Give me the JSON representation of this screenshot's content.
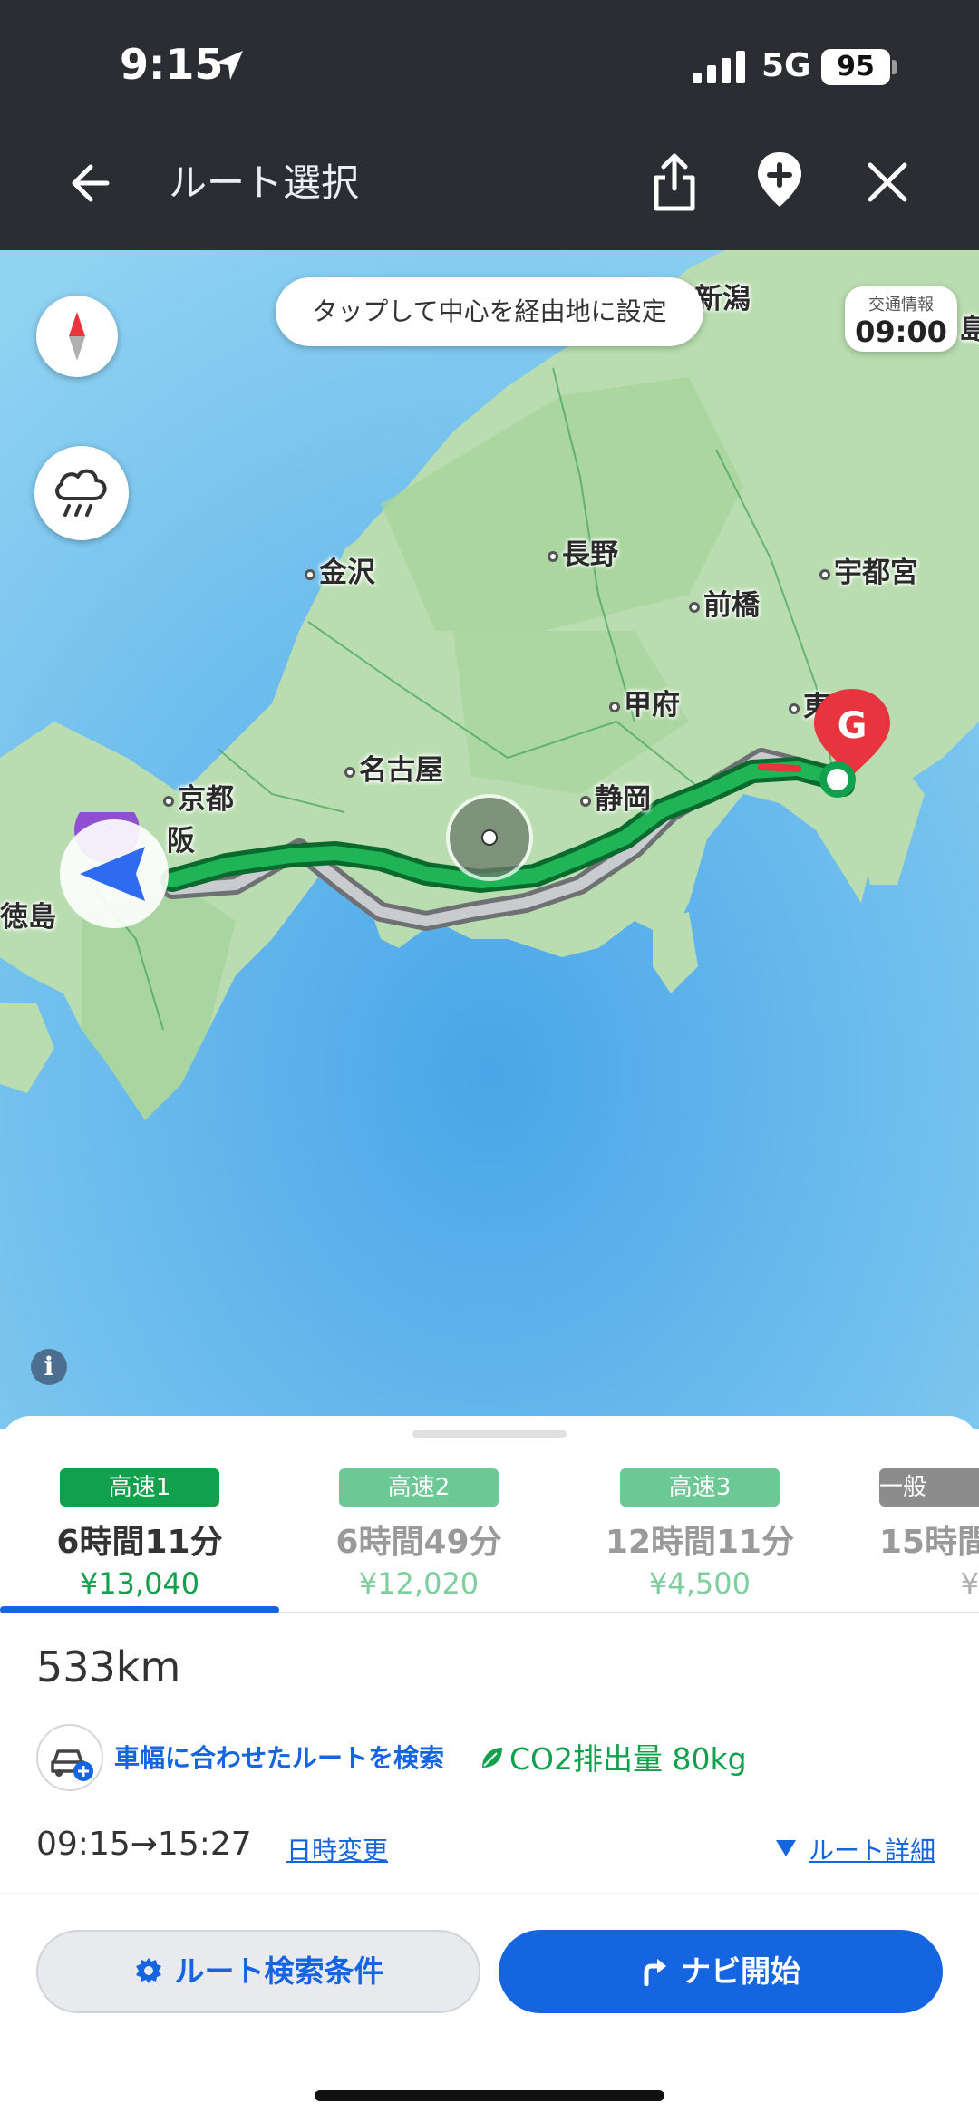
{
  "status_bar": {
    "time": "9:15",
    "network": "5G",
    "battery": "95"
  },
  "top_bar": {
    "title": "ルート選択"
  },
  "map": {
    "tap_hint": "タップして中心を経由地に設定",
    "traffic": {
      "label": "交通情報",
      "time": "09:00"
    },
    "info": "i",
    "goal_label": "G",
    "cities": {
      "niigata": "新潟",
      "kanazawa": "金沢",
      "nagano": "長野",
      "utsunomiya": "宇都宮",
      "maebashi": "前橋",
      "kofu": "甲府",
      "tokyo": "東",
      "nagoya": "名古屋",
      "kyoto": "京都",
      "shizuoka": "静岡",
      "osaka": "阪",
      "tokushima": "徳島",
      "fuku": "島"
    }
  },
  "routes": [
    {
      "tag": "高速1",
      "time": "6時間11分",
      "price": "¥13,040",
      "tag_color": "#11a04b"
    },
    {
      "tag": "高速2",
      "time": "6時間49分",
      "price": "¥12,020",
      "tag_color": "#6cc894"
    },
    {
      "tag": "高速3",
      "time": "12時間11分",
      "price": "¥4,500",
      "tag_color": "#6cc894"
    },
    {
      "tag": "一般",
      "time": "15時間",
      "price": "¥",
      "tag_color": "#8c8c8c"
    }
  ],
  "summary": {
    "distance": "533km",
    "vehicle_link": "車幅に合わせたルートを検索",
    "co2": "CO2排出量 80kg",
    "time_range": "09:15→15:27",
    "date_change": "日時変更",
    "route_detail": "ルート詳細"
  },
  "actions": {
    "conditions": "ルート検索条件",
    "navi": "ナビ開始"
  },
  "colors": {
    "accent": "#1565e0",
    "route_green": "#11a04b",
    "goal_red": "#e8343e"
  }
}
